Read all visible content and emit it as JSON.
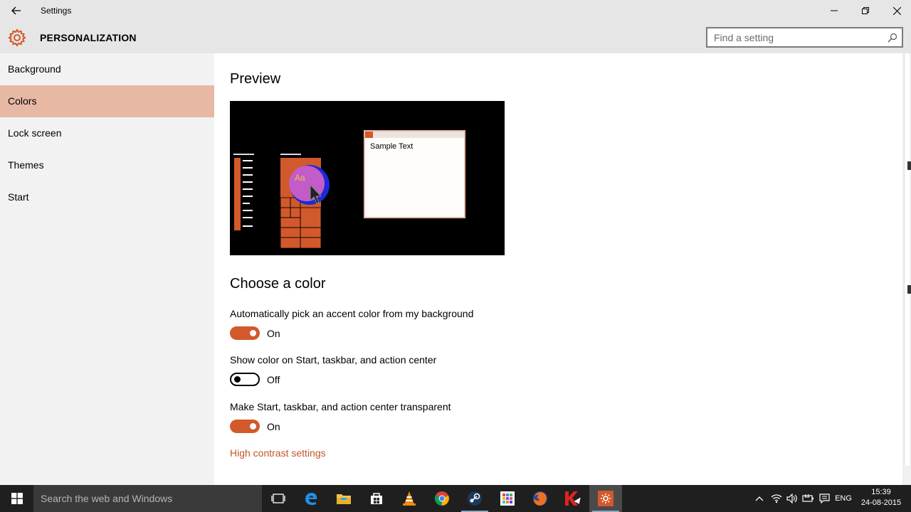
{
  "window": {
    "title": "Settings"
  },
  "header": {
    "section_title": "PERSONALIZATION",
    "search_placeholder": "Find a setting"
  },
  "sidebar": {
    "items": [
      {
        "label": "Background"
      },
      {
        "label": "Colors"
      },
      {
        "label": "Lock screen"
      },
      {
        "label": "Themes"
      },
      {
        "label": "Start"
      }
    ],
    "active_index": 1
  },
  "main": {
    "preview_heading": "Preview",
    "preview_sample_text": "Sample Text",
    "preview_tile_text": "Aa",
    "choose_heading": "Choose a color",
    "settings": [
      {
        "label": "Automatically pick an accent color from my background",
        "state": "On"
      },
      {
        "label": "Show color on Start, taskbar, and action center",
        "state": "Off"
      },
      {
        "label": "Make Start, taskbar, and action center transparent",
        "state": "On"
      }
    ],
    "high_contrast_link": "High contrast settings"
  },
  "taskbar": {
    "search_placeholder": "Search the web and Windows",
    "apps": [
      "task-view",
      "edge",
      "file-explorer",
      "store",
      "vlc",
      "chrome",
      "steam",
      "app-grid",
      "firefox",
      "kaspersky",
      "settings"
    ],
    "language": "ENG",
    "time": "15:39",
    "date": "24-08-2015"
  },
  "colors": {
    "accent": "#d2592b",
    "sidebar_active": "#e7b8a4",
    "link": "#c0562a",
    "chrome_gray": "#e6e6e6"
  }
}
